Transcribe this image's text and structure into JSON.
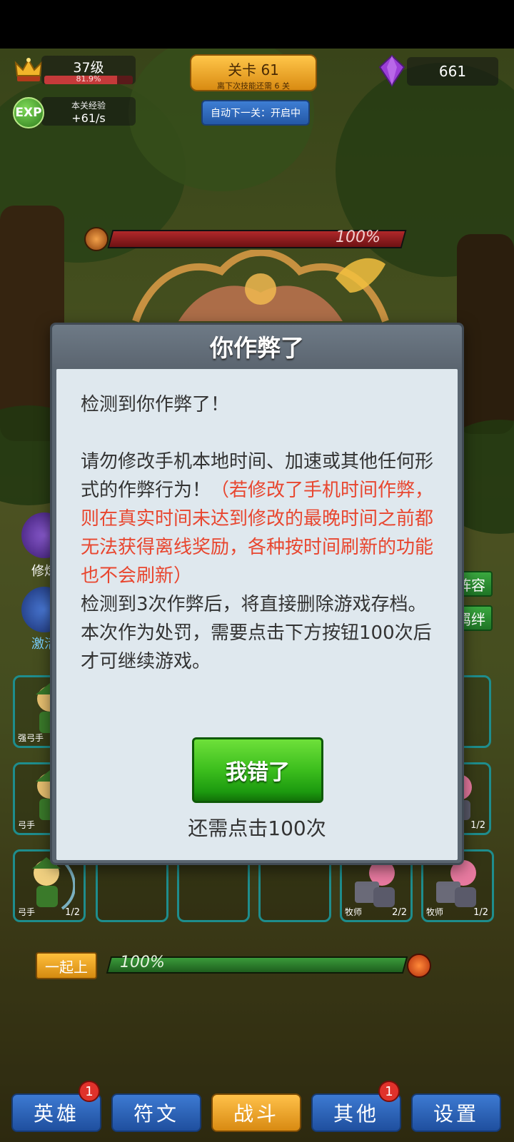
{
  "hud": {
    "level": "37级",
    "level_progress": "81.9%",
    "level_progress_fraction": 0.819,
    "exp_badge": "EXP",
    "exp_title": "本关经验",
    "exp_rate": "+61/s",
    "stage": "关卡 61",
    "stage_sub": "离下次技能还需 6 关",
    "auto_next": "自动下一关：开启中",
    "gems": "661"
  },
  "boss": {
    "hp_percent": "100%",
    "hp_fraction": 1.0
  },
  "side": {
    "left_items": [
      "修炼",
      "激活"
    ],
    "right_items": [
      "阵容",
      "羁绊"
    ]
  },
  "slots": [
    {
      "label": "强弓手",
      "count": ""
    },
    {
      "label": "弓手",
      "count": "1/2"
    },
    {
      "label": "弓手",
      "count": "1/2"
    },
    {
      "label": "牧师",
      "count": "2/2"
    },
    {
      "label": "牧师",
      "count": "1/2"
    },
    {
      "label": "牧师",
      "count": "1/2"
    }
  ],
  "bottom": {
    "together_label": "一起上",
    "progress_percent": "100%",
    "progress_fraction": 1.0
  },
  "nav": [
    {
      "label": "英雄",
      "badge": "1"
    },
    {
      "label": "符文",
      "badge": ""
    },
    {
      "label": "战斗",
      "badge": ""
    },
    {
      "label": "其他",
      "badge": "1"
    },
    {
      "label": "设置",
      "badge": ""
    }
  ],
  "modal": {
    "title": "你作弊了",
    "line1": "检测到你作弊了！",
    "line2_normal": "请勿修改手机本地时间、加速或其他任何形式的作弊行为！",
    "line2_warn": "（若修改了手机时间作弊，则在真实时间未达到修改的最晚时间之前都无法获得离线奖励，各种按时间刷新的功能也不会刷新）",
    "line3": "检测到3次作弊后，将直接删除游戏存档。",
    "line4": "本次作为处罚，需要点击下方按钮100次后才可继续游戏。",
    "confirm_button": "我错了",
    "remaining": "还需点击100次"
  },
  "colors": {
    "warn_text": "#e8462f",
    "confirm_green": "#3cbe1d",
    "nav_blue": "#2f62b8",
    "nav_active": "#f0a830"
  }
}
